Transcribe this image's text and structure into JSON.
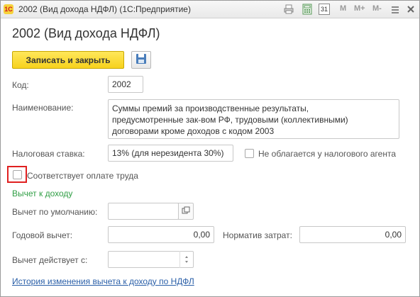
{
  "window": {
    "title": "2002 (Вид дохода НДФЛ)  (1С:Предприятие)",
    "toolbar_memory": [
      "M",
      "M+",
      "M-"
    ],
    "calendar_day": "31"
  },
  "form": {
    "title": "2002 (Вид дохода НДФЛ)",
    "save_close_label": "Записать и закрыть",
    "code_label": "Код:",
    "code_value": "2002",
    "name_label": "Наименование:",
    "name_lines": [
      "Суммы премий за производственные результаты,",
      "предусмотренные зак-вом РФ, трудовыми (коллективными)",
      "договорами кроме доходов с кодом 2003"
    ],
    "tax_rate_label": "Налоговая ставка:",
    "tax_rate_value": "13% (для нерезидента 30%)",
    "not_taxed_label": "Не облагается у налогового агента",
    "not_taxed_checked": false,
    "labor_pay_label": "Соответствует оплате труда",
    "labor_pay_checked": false,
    "deduction_section": "Вычет к доходу",
    "default_deduction_label": "Вычет по умолчанию:",
    "default_deduction_value": "",
    "annual_deduction_label": "Годовой вычет:",
    "annual_deduction_value": "0,00",
    "cost_norm_label": "Норматив затрат:",
    "cost_norm_value": "0,00",
    "deduction_from_label": "Вычет действует с:",
    "deduction_from_value": "",
    "history_link": "История изменения вычета к доходу по НДФЛ"
  },
  "colors": {
    "primary_button": "#f7d21c",
    "section": "#2f9e44",
    "link": "#2a5fa8",
    "highlight": "#e02020"
  }
}
